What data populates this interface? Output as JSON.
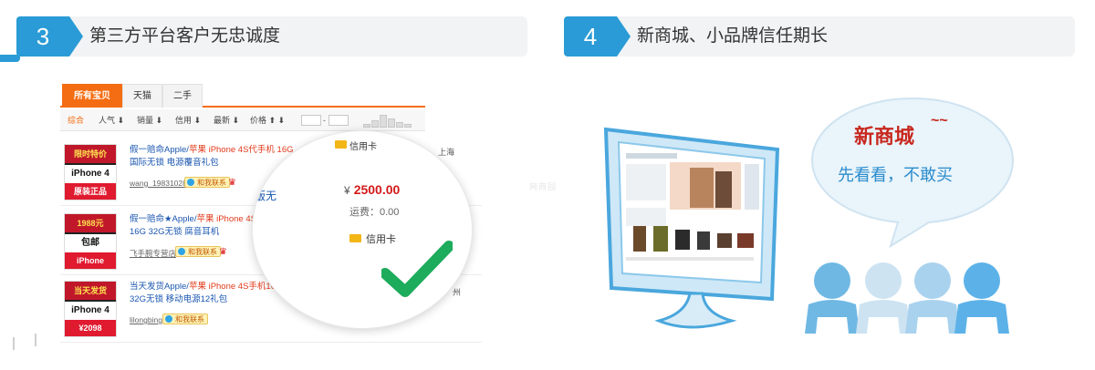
{
  "colors": {
    "header_blue": "#2a9bd6",
    "tab_orange": "#f46d12",
    "price_red": "#d41a1a",
    "check_green": "#1dab5c",
    "title_red": "#c8281e",
    "sub_blue": "#2b8ccc",
    "people_blue": "#6fb8e4",
    "people_light": "#cde3f2"
  },
  "section1": {
    "number": "3",
    "title": "第三方平台客户无忠诚度"
  },
  "section2": {
    "number": "4",
    "title": "新商城、小品牌信任期长"
  },
  "listing": {
    "tabs": [
      "所有宝贝",
      "天猫",
      "二手"
    ],
    "filters": [
      "综合",
      "人气",
      "销量",
      "信用",
      "最新",
      "价格"
    ],
    "price_dash": "-",
    "rows": [
      {
        "title_pre": "假一赔命Apple/",
        "title_hl": "苹果 iPhone 4S代手机 16G",
        "title_post": "国际无锁 电源覆音礼包",
        "seller": "wang_19831028",
        "badge": "和我联系",
        "location": "上海",
        "thumb_top": "限时特价",
        "thumb_mid": "iPhone 4",
        "thumb_bot": "原装正品"
      },
      {
        "title_pre": "假一赔命★Apple/",
        "title_hl": "苹果 iPhone 4S",
        "title_post": "16G 32G无锁 腐音耳机",
        "seller": "飞手腕专营店",
        "badge": "和我联系",
        "location": "",
        "thumb_top": "1988元",
        "thumb_mid": "包邮",
        "thumb_bot": "iPhone"
      },
      {
        "title_pre": "当天发货Apple/",
        "title_hl": "苹果 iPhone 4S手机16",
        "title_post": "32G无锁 移动电源12礼包",
        "seller": "lilongbing",
        "badge": "和我联系",
        "location": "州",
        "thumb_top": "当天发货",
        "thumb_mid": "iPhone 4",
        "thumb_bot": "¥2098"
      }
    ]
  },
  "zoom": {
    "credit_top": "信用卡",
    "currency": "¥",
    "price": "2500.00",
    "shipping": "运费：0.00",
    "credit": "信用卡",
    "left_text": "版无"
  },
  "watermark": "网商园",
  "bubble": {
    "title": "新商城",
    "title_sup": "~~",
    "subtitle": "先看看，不敢买"
  },
  "icons": [
    "check-icon",
    "monitor-icon",
    "speech-bubble-icon",
    "people-icon",
    "wangwang-icon",
    "crown-icon"
  ]
}
